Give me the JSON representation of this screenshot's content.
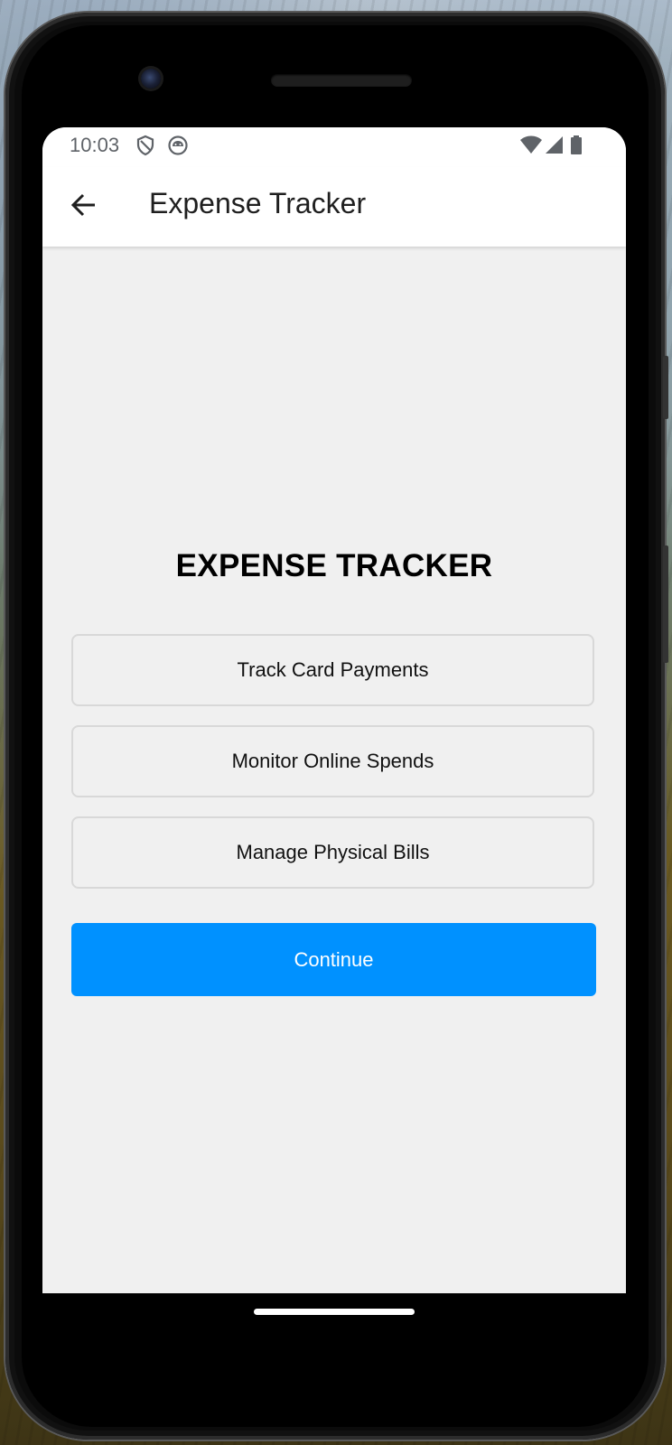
{
  "status_bar": {
    "time": "10:03",
    "left_icons": [
      "shield-icon",
      "android-face-icon"
    ],
    "right_icons": [
      "wifi-icon",
      "cell-signal-icon",
      "battery-icon"
    ]
  },
  "app_bar": {
    "back_icon": "arrow-left-icon",
    "title": "Expense Tracker"
  },
  "main": {
    "heading": "EXPENSE TRACKER",
    "options": [
      {
        "label": "Track Card Payments"
      },
      {
        "label": "Monitor Online Spends"
      },
      {
        "label": "Manage Physical Bills"
      }
    ],
    "continue_label": "Continue"
  },
  "colors": {
    "accent": "#0091ff",
    "screen_bg": "#f0f0f0",
    "app_bar_bg": "#ffffff",
    "option_border": "#d8d8d8"
  }
}
